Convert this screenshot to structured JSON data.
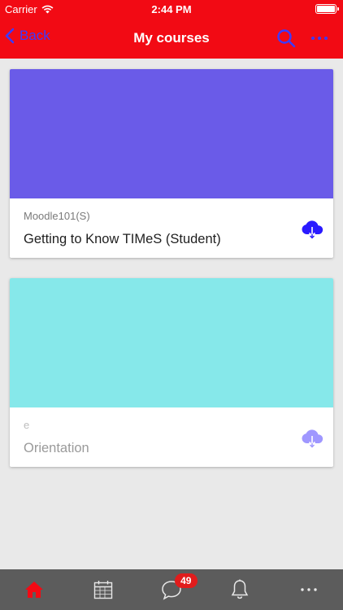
{
  "status_bar": {
    "carrier": "Carrier",
    "time": "2:44 PM"
  },
  "nav": {
    "back_label": "Back",
    "title": "My courses",
    "search_icon": "search-icon",
    "more_icon": "more-icon"
  },
  "courses": [
    {
      "short_name": "Moodle101(S)",
      "full_name": "Getting to Know TIMeS (Student)",
      "banner_color": "#6a5be8",
      "download_icon_color": "#2a1aff"
    },
    {
      "short_name": "e",
      "full_name": "Orientation",
      "banner_color": "#86e8ea",
      "download_icon_color": "#9f97ff"
    }
  ],
  "tabs": [
    {
      "name": "home",
      "icon": "home-icon",
      "active": true
    },
    {
      "name": "calendar",
      "icon": "calendar-icon"
    },
    {
      "name": "messages",
      "icon": "chat-icon",
      "badge": "49"
    },
    {
      "name": "notifications",
      "icon": "bell-icon"
    },
    {
      "name": "more",
      "icon": "more-icon"
    }
  ],
  "colors": {
    "header": "#f20a14",
    "accent": "#3b3bff",
    "tab_bar": "#5c5c5c",
    "tab_active": "#f20a14",
    "badge": "#e11c1c"
  }
}
